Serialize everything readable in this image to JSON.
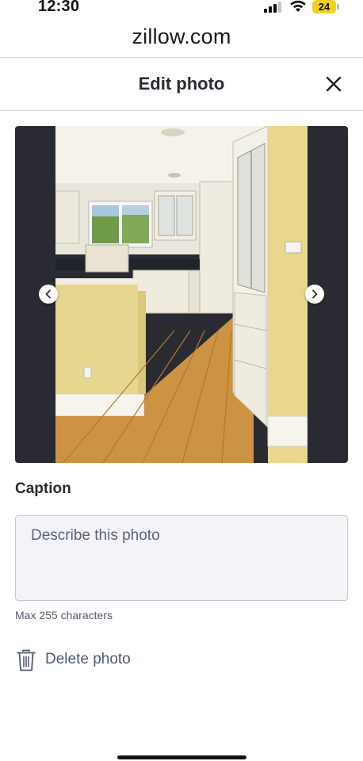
{
  "status_bar": {
    "time": "12:30",
    "battery_level": "24",
    "signal_icon": "cellular-signal-icon",
    "wifi_icon": "wifi-icon",
    "battery_color": "#f2d21e"
  },
  "browser": {
    "url": "zillow.com"
  },
  "header": {
    "title": "Edit photo",
    "close_icon": "close-icon"
  },
  "photo_viewer": {
    "prev_icon": "chevron-left-icon",
    "next_icon": "chevron-right-icon"
  },
  "caption": {
    "label": "Caption",
    "placeholder": "Describe this photo",
    "value": "",
    "hint": "Max 255 characters"
  },
  "delete": {
    "label": "Delete photo",
    "icon": "trash-icon"
  },
  "colors": {
    "text_primary": "#2a2a33",
    "viewer_background": "#2a2a33",
    "input_background": "#f3f3f8",
    "link_gray": "#4f5b73"
  }
}
